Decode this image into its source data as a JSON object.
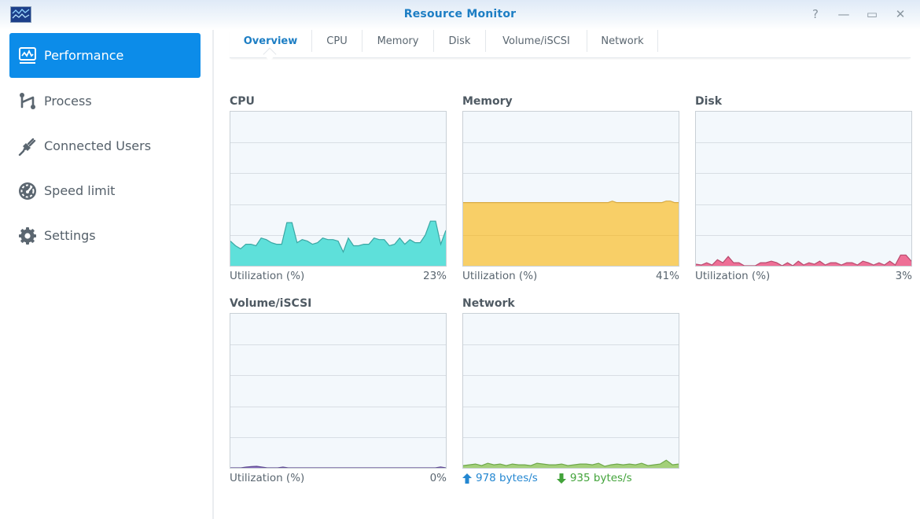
{
  "window": {
    "title": "Resource Monitor",
    "app_icon": "resource-monitor-icon",
    "controls": [
      {
        "name": "help-button",
        "icon": "help-icon",
        "glyph": "?"
      },
      {
        "name": "minimize-button",
        "icon": "minimize-icon",
        "glyph": "—"
      },
      {
        "name": "maximize-button",
        "icon": "maximize-icon",
        "glyph": "▭"
      },
      {
        "name": "close-button",
        "icon": "close-icon",
        "glyph": "✕"
      }
    ]
  },
  "sidebar": {
    "items": [
      {
        "label": "Performance",
        "icon": "performance-icon",
        "active": true
      },
      {
        "label": "Process",
        "icon": "process-icon",
        "active": false
      },
      {
        "label": "Connected Users",
        "icon": "plug-icon",
        "active": false
      },
      {
        "label": "Speed limit",
        "icon": "speedometer-icon",
        "active": false
      },
      {
        "label": "Settings",
        "icon": "gear-icon",
        "active": false
      }
    ]
  },
  "tabs": [
    {
      "label": "Overview",
      "active": true
    },
    {
      "label": "CPU",
      "active": false
    },
    {
      "label": "Memory",
      "active": false
    },
    {
      "label": "Disk",
      "active": false
    },
    {
      "label": "Volume/iSCSI",
      "active": false
    },
    {
      "label": "Network",
      "active": false
    }
  ],
  "colors": {
    "accent": "#0c8ce9",
    "title": "#1d7ec4",
    "cpu_fill": "#5ee0da",
    "cpu_line": "#3aa7a4",
    "memory_fill": "#f8cf67",
    "memory_line": "#d8ab45",
    "disk_fill": "#ee6f96",
    "disk_line": "#b84a6d",
    "volume_fill": "#8a6cc0",
    "volume_line": "#5e4a90",
    "network_fill": "#a3d07a",
    "network_line": "#6ea84a",
    "net_up": "#2487d1",
    "net_down": "#42a33a"
  },
  "panels": {
    "cpu": {
      "title": "CPU",
      "caption_label": "Utilization (%)",
      "value": "23%"
    },
    "memory": {
      "title": "Memory",
      "caption_label": "Utilization (%)",
      "value": "41%"
    },
    "disk": {
      "title": "Disk",
      "caption_label": "Utilization (%)",
      "value": "3%"
    },
    "volume": {
      "title": "Volume/iSCSI",
      "caption_label": "Utilization (%)",
      "value": "0%"
    },
    "network": {
      "title": "Network",
      "upload": "978 bytes/s",
      "download": "935 bytes/s",
      "upload_icon": "arrow-up-icon",
      "download_icon": "arrow-down-icon"
    }
  },
  "chart_data": [
    {
      "type": "area",
      "id": "cpu",
      "title": "CPU",
      "ylabel": "Utilization (%)",
      "ylim": [
        0,
        100
      ],
      "grid": true,
      "values": [
        16,
        13,
        11,
        14,
        14,
        13,
        18,
        17,
        15,
        14,
        14,
        28,
        28,
        15,
        17,
        16,
        14,
        15,
        18,
        17,
        17,
        16,
        9,
        18,
        13,
        13,
        14,
        14,
        18,
        17,
        17,
        13,
        14,
        18,
        14,
        17,
        15,
        15,
        20,
        29,
        29,
        14,
        23
      ]
    },
    {
      "type": "area",
      "id": "memory",
      "title": "Memory",
      "ylabel": "Utilization (%)",
      "ylim": [
        0,
        100
      ],
      "grid": true,
      "values": [
        41,
        41,
        41,
        41,
        41,
        41,
        41,
        41,
        41,
        41,
        41,
        41,
        41,
        41,
        41,
        41,
        41,
        41,
        41,
        41,
        41,
        41,
        41,
        41,
        41,
        41,
        41,
        41,
        41,
        41,
        41,
        41,
        41,
        41,
        41,
        41,
        42,
        41,
        41,
        41,
        41,
        41,
        41,
        41,
        41,
        41,
        41,
        41,
        41,
        42,
        42,
        41,
        41
      ]
    },
    {
      "type": "area",
      "id": "disk",
      "title": "Disk",
      "ylabel": "Utilization (%)",
      "ylim": [
        0,
        100
      ],
      "grid": true,
      "values": [
        1,
        0.5,
        2,
        0.5,
        4,
        2,
        6,
        2,
        2,
        0,
        0,
        0,
        2,
        2,
        3,
        2,
        0,
        2,
        0,
        3,
        0.5,
        2,
        1,
        3,
        0.5,
        2,
        2,
        0.5,
        2,
        2,
        0.5,
        3,
        2,
        0.5,
        2,
        0.5,
        3,
        0.5,
        7,
        7,
        3
      ]
    },
    {
      "type": "area",
      "id": "volume",
      "title": "Volume/iSCSI",
      "ylabel": "Utilization (%)",
      "ylim": [
        0,
        100
      ],
      "grid": true,
      "values": [
        0,
        0,
        0,
        0.5,
        0.8,
        1,
        0.5,
        0,
        0,
        0,
        0.5,
        0,
        0,
        0,
        0,
        0,
        0,
        0,
        0,
        0,
        0,
        0,
        0,
        0,
        0,
        0,
        0,
        0,
        0,
        0,
        0,
        0,
        0,
        0,
        0,
        0,
        0,
        0,
        0,
        0,
        0.6,
        0
      ]
    },
    {
      "type": "area",
      "id": "network",
      "title": "Network",
      "ylabel": "bytes/s",
      "ylim": [
        0,
        100
      ],
      "grid": true,
      "values": [
        1.5,
        2,
        2.5,
        1.5,
        3,
        2,
        2.5,
        1.5,
        2.5,
        2,
        2,
        1.5,
        3,
        2.5,
        2,
        2,
        2.5,
        1.5,
        2,
        2.5,
        2.5,
        2,
        3,
        1,
        2,
        2.5,
        2,
        2.5,
        2,
        3,
        1.5,
        2,
        2.5,
        5,
        2,
        2.5
      ],
      "legend": [
        "978 bytes/s (up)",
        "935 bytes/s (down)"
      ]
    }
  ]
}
